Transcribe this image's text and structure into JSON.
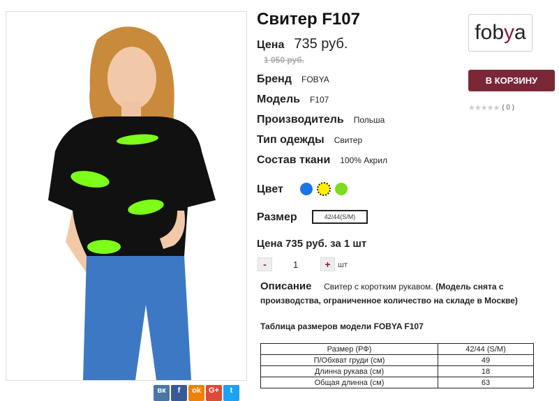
{
  "product": {
    "title": "Свитер F107",
    "price_label": "Цена",
    "price": "735 руб.",
    "old_price": "1 050 руб.",
    "attributes": [
      {
        "label": "Бренд",
        "value": "FOBYA"
      },
      {
        "label": "Модель",
        "value": "F107"
      },
      {
        "label": "Производитель",
        "value": "Польша"
      },
      {
        "label": "Тип одежды",
        "value": "Свитер"
      },
      {
        "label": "Состав ткани",
        "value": "100% Акрил"
      }
    ],
    "color_label": "Цвет",
    "colors": [
      "#1a73e8",
      "#ffee00",
      "#7ddc1f"
    ],
    "size_label": "Размер",
    "size_value": "42/44(S/M)",
    "price_per_unit": "Цена 735 руб. за 1 шт",
    "quantity": {
      "minus": "-",
      "value": "1",
      "plus": "+",
      "unit": "шт"
    }
  },
  "description": {
    "label": "Описание",
    "text": "Свитер с коротким рукавом.",
    "bold_text": "(Модель снята с производства, ограниченное количество на складе в Москве)"
  },
  "size_table": {
    "title": "Таблица размеров модели FOBYA F107",
    "rows": [
      [
        "Размер (РФ)",
        "42/44 (S/M)"
      ],
      [
        "П/Обхват груди (см)",
        "49"
      ],
      [
        "Длинна рукава (см)",
        "18"
      ],
      [
        "Общая длинна (см)",
        "63"
      ]
    ]
  },
  "brand_logo": {
    "text_main": "fob",
    "text_accent": "y",
    "text_end": "a"
  },
  "cart_button": "В КОРЗИНУ",
  "rating": {
    "stars": "★★★★★",
    "count": "( 0 )"
  },
  "share": [
    {
      "icon": "vk-icon",
      "label": "вк",
      "color": "#4a76a8"
    },
    {
      "icon": "facebook-icon",
      "label": "f",
      "color": "#3b5998"
    },
    {
      "icon": "odnoklassniki-icon",
      "label": "ok",
      "color": "#ee8208"
    },
    {
      "icon": "googleplus-icon",
      "label": "G+",
      "color": "#dd4b39"
    },
    {
      "icon": "twitter-icon",
      "label": "t",
      "color": "#1da1f2"
    }
  ]
}
